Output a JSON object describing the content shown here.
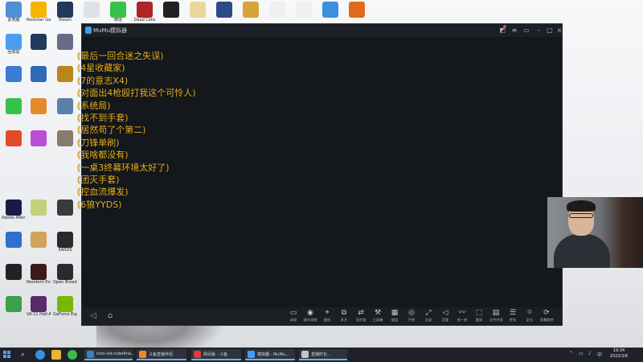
{
  "emulator": {
    "title": "MuMu模拟器",
    "danmaku": [
      "(最后一回合迷之失误)",
      "(4星收藏家)",
      "(7的意志X4)",
      "(对面出4枪殴打我这个可怜人)",
      "(系统局)",
      "(找不到手套)",
      "(居然苟了个第二)",
      "(刀锋单刷)",
      "(我啥都没有)",
      "(一桌3终幕环境太好了)",
      "(团灭手套)",
      "(控血流爆发)",
      "(6狼YYDS)"
    ],
    "toolbar": [
      {
        "icon": "video-icon",
        "label": "录屏"
      },
      {
        "icon": "macro-icon",
        "label": "操作录制"
      },
      {
        "icon": "keymap-icon",
        "label": "键鼠"
      },
      {
        "icon": "multi-icon",
        "label": "多开"
      },
      {
        "icon": "sync-icon",
        "label": "同步器"
      },
      {
        "icon": "tools-icon",
        "label": "工具箱"
      },
      {
        "icon": "keyboard-icon",
        "label": "键盘"
      },
      {
        "icon": "gamepad-icon",
        "label": "手柄"
      },
      {
        "icon": "fullscreen-icon",
        "label": "全屏"
      },
      {
        "icon": "volume-icon",
        "label": "音量"
      },
      {
        "icon": "shake-icon",
        "label": "摇一摇"
      },
      {
        "icon": "screenshot-icon",
        "label": "截屏"
      },
      {
        "icon": "folder-icon",
        "label": "文件共享"
      },
      {
        "icon": "more-icon",
        "label": "更多"
      },
      {
        "icon": "location-icon",
        "label": "定位"
      },
      {
        "icon": "rotate-icon",
        "label": "屏幕旋转"
      }
    ]
  },
  "desktop_icons": [
    {
      "label": "此电脑",
      "color": "#4f8fd8"
    },
    {
      "label": "Rockstar Games",
      "color": "#f4b400"
    },
    {
      "label": "Steam",
      "color": "#223a5a"
    },
    {
      "label": "",
      "color": "#dfe3e8"
    },
    {
      "label": "微信",
      "color": "#35c24a"
    },
    {
      "label": "Dead Cells",
      "color": "#b12424"
    },
    {
      "label": "",
      "color": "#222"
    },
    {
      "label": "",
      "color": "#e8d99a"
    },
    {
      "label": "",
      "color": "#2c4c86"
    },
    {
      "label": "",
      "color": "#d6a43a"
    },
    {
      "label": "",
      "color": "#eef0f2"
    },
    {
      "label": "",
      "color": "#eef0f2"
    },
    {
      "label": "",
      "color": "#3a8fe0"
    },
    {
      "label": "",
      "color": "#e06a1a"
    },
    {
      "label": "回收站",
      "color": "#4a9ef0"
    },
    {
      "label": "",
      "color": "#1e3a5e"
    },
    {
      "label": "",
      "color": "#6a6a8a"
    },
    {
      "label": "",
      "color": "#3a7bd5"
    },
    {
      "label": "",
      "color": "#2e6ab8"
    },
    {
      "label": "",
      "color": "#b8861a"
    },
    {
      "label": "",
      "color": "#35c24a"
    },
    {
      "label": "",
      "color": "#e58a2b"
    },
    {
      "label": "",
      "color": "#5b7fa8"
    },
    {
      "label": "",
      "color": "#e34b2a"
    },
    {
      "label": "",
      "color": "#b84fd6"
    },
    {
      "label": "",
      "color": "#8a7a6a"
    },
    {
      "label": "Adobe After Effects",
      "color": "#1a1a4a"
    },
    {
      "label": "",
      "color": "#c6d07a"
    },
    {
      "label": "",
      "color": "#3a3a3a"
    },
    {
      "label": "",
      "color": "#2f6fd0"
    },
    {
      "label": "",
      "color": "#cfa35a"
    },
    {
      "label": "KARDS",
      "color": "#2a2a2a"
    },
    {
      "label": "",
      "color": "#222"
    },
    {
      "label": "Resident Evil",
      "color": "#3a1a1a"
    },
    {
      "label": "Open Broadcaster",
      "color": "#2a2a2a"
    },
    {
      "label": "",
      "color": "#3aa04a"
    },
    {
      "label": "VA-11 Hall-A",
      "color": "#5a2a6a"
    },
    {
      "label": "GeForce Experience",
      "color": "#76b900"
    }
  ],
  "taskbar": {
    "tasks": [
      {
        "label": "icon-vst-cube4na…",
        "color": "#3b82c4"
      },
      {
        "label": "斗鱼直播伴侣",
        "color": "#f08a1a"
      },
      {
        "label": "网页版 - 斗鱼",
        "color": "#e23a3a"
      },
      {
        "label": "模拟器 - MuMu…",
        "color": "#3aa0ff"
      },
      {
        "label": "直播时长…",
        "color": "#c6c6c6"
      }
    ],
    "clock_time": "19:34",
    "clock_date": "2022/3/6"
  }
}
